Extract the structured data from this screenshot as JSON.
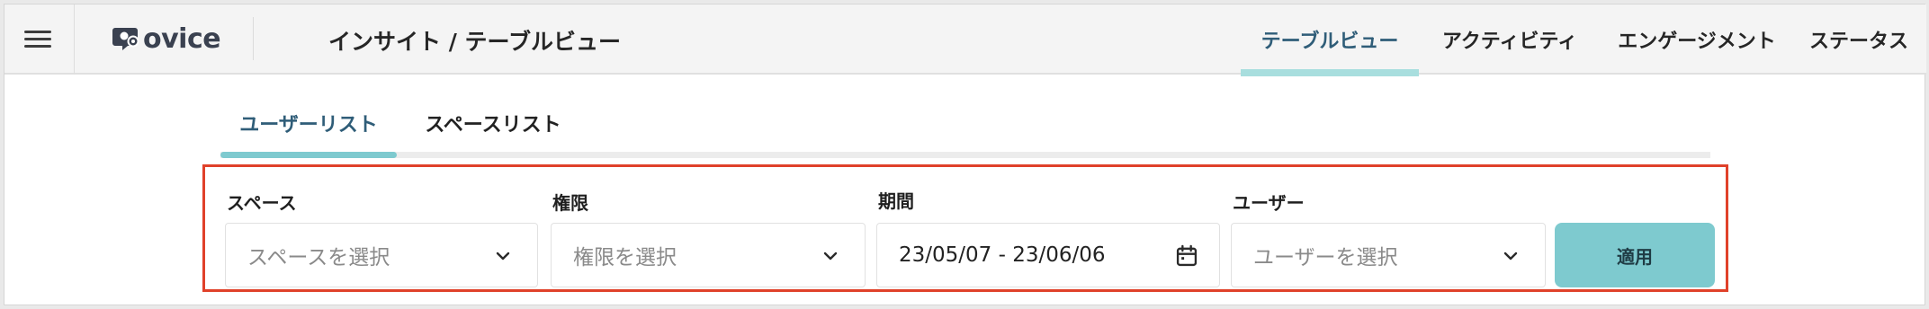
{
  "header": {
    "logo_text": "ovice",
    "page_title": "インサイト / テーブルビュー",
    "nav": [
      {
        "label": "テーブルビュー",
        "active": true
      },
      {
        "label": "アクティビティ",
        "active": false
      },
      {
        "label": "エンゲージメント",
        "active": false
      },
      {
        "label": "ステータス",
        "active": false
      }
    ]
  },
  "subtabs": [
    {
      "label": "ユーザーリスト",
      "active": true
    },
    {
      "label": "スペースリスト",
      "active": false
    }
  ],
  "filters": {
    "space": {
      "label": "スペース",
      "placeholder": "スペースを選択",
      "icon": "chevron-down-icon"
    },
    "permission": {
      "label": "権限",
      "placeholder": "権限を選択",
      "icon": "chevron-down-icon"
    },
    "period": {
      "label": "期間",
      "value": "23/05/07 - 23/06/06",
      "icon": "calendar-icon"
    },
    "user": {
      "label": "ユーザー",
      "placeholder": "ユーザーを選択",
      "icon": "chevron-down-icon"
    },
    "apply_label": "適用"
  },
  "colors": {
    "accent": "#7ecacf",
    "active_text": "#2f5d78",
    "highlight_border": "#e0412a"
  }
}
